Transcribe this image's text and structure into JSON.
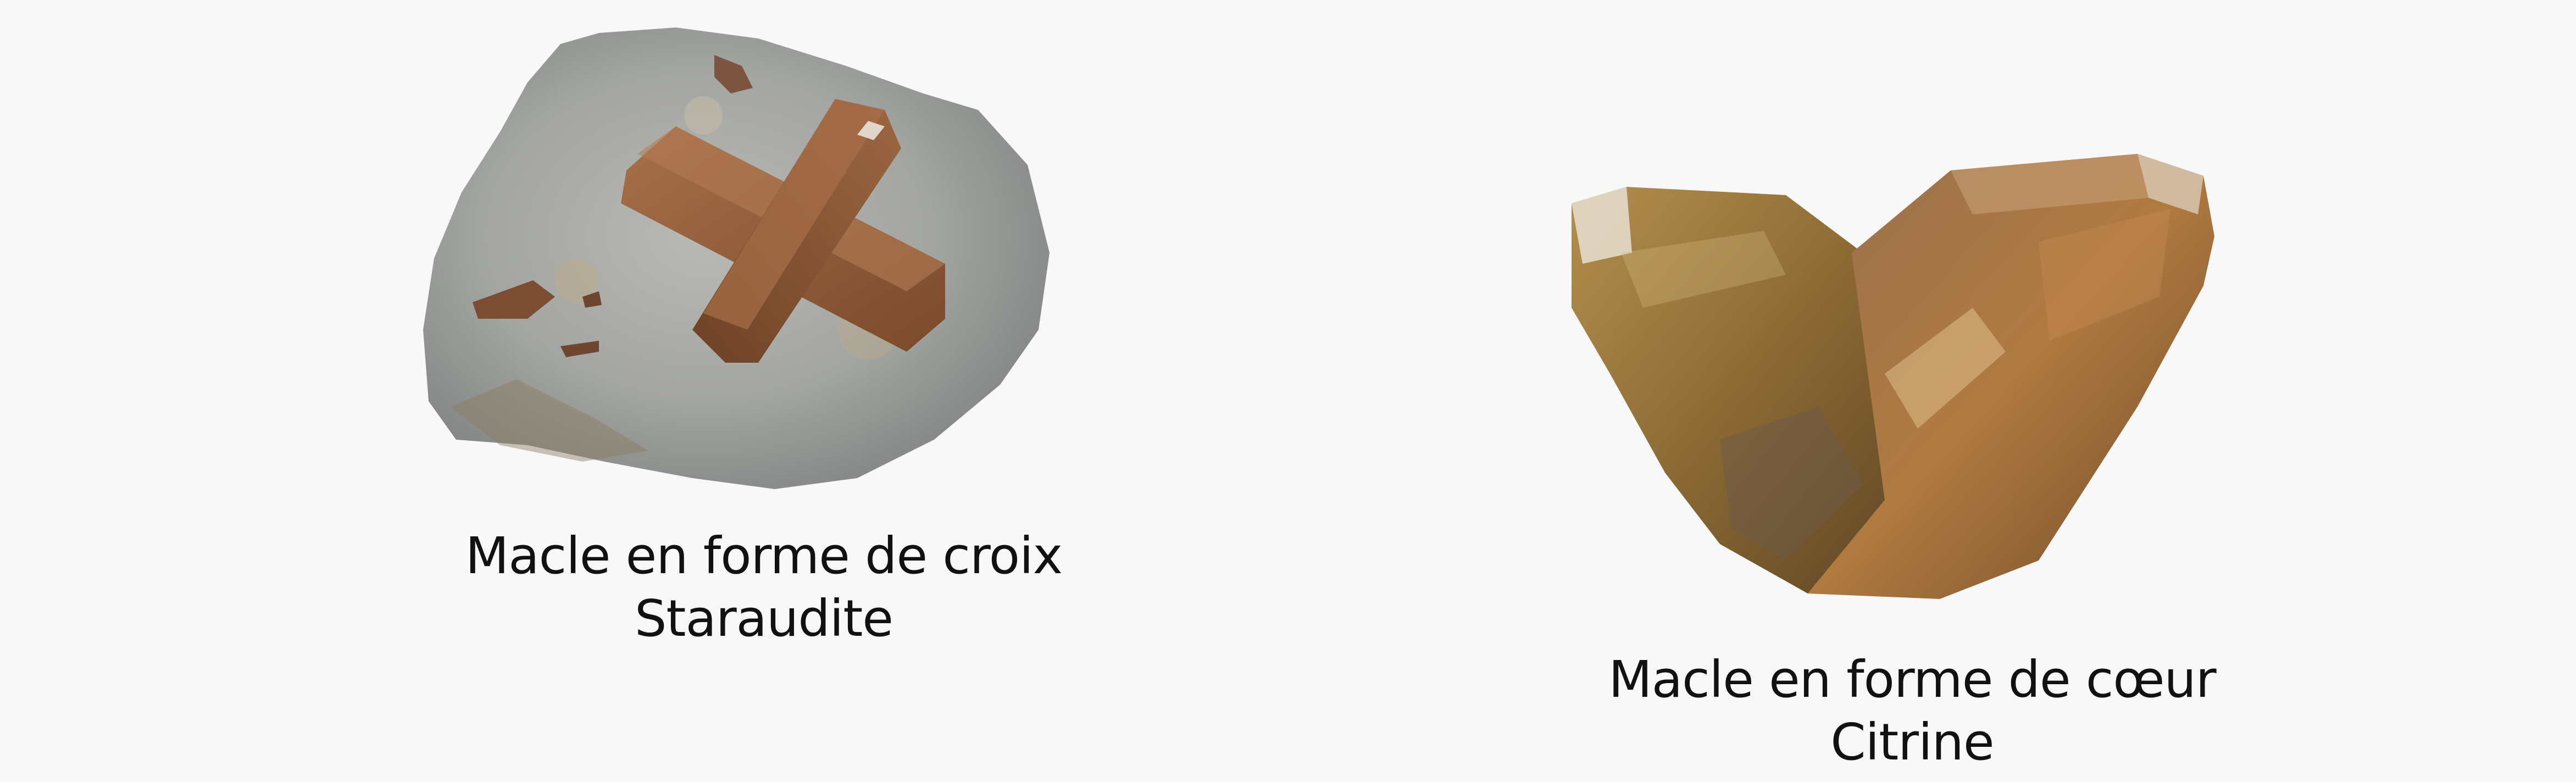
{
  "specimens": [
    {
      "image": "staurolite-cross-twin-photo",
      "title": "Macle en forme de croix",
      "mineral": "Staraudite"
    },
    {
      "image": "citrine-heart-twin-photo",
      "title": "Macle en forme de cœur",
      "mineral": "Citrine"
    }
  ]
}
